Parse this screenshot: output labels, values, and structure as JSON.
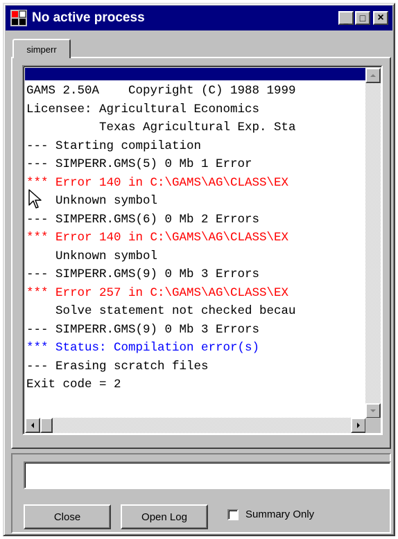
{
  "window": {
    "title": "No active process",
    "icon": "gams-app-icon",
    "controls": {
      "minimize": "_",
      "maximize": "□",
      "close": "×"
    }
  },
  "tabs": [
    {
      "label": "simperr"
    }
  ],
  "log": {
    "lines": [
      {
        "text": "GAMS 2.50A    Copyright (C) 1988 1999",
        "color": "black"
      },
      {
        "text": "Licensee: Agricultural Economics",
        "color": "black"
      },
      {
        "text": "          Texas Agricultural Exp. Sta",
        "color": "black"
      },
      {
        "text": "--- Starting compilation",
        "color": "black"
      },
      {
        "text": "--- SIMPERR.GMS(5) 0 Mb 1 Error",
        "color": "black"
      },
      {
        "text": "*** Error 140 in C:\\GAMS\\AG\\CLASS\\EX",
        "color": "red"
      },
      {
        "text": "    Unknown symbol",
        "color": "black"
      },
      {
        "text": "--- SIMPERR.GMS(6) 0 Mb 2 Errors",
        "color": "black"
      },
      {
        "text": "*** Error 140 in C:\\GAMS\\AG\\CLASS\\EX",
        "color": "red"
      },
      {
        "text": "    Unknown symbol",
        "color": "black"
      },
      {
        "text": "--- SIMPERR.GMS(9) 0 Mb 3 Errors",
        "color": "black"
      },
      {
        "text": "*** Error 257 in C:\\GAMS\\AG\\CLASS\\EX",
        "color": "red"
      },
      {
        "text": "    Solve statement not checked becau",
        "color": "black"
      },
      {
        "text": "--- SIMPERR.GMS(9) 0 Mb 3 Errors",
        "color": "black"
      },
      {
        "text": "*** Status: Compilation error(s)",
        "color": "blue"
      },
      {
        "text": "--- Erasing scratch files",
        "color": "black"
      },
      {
        "text": "Exit code = 2",
        "color": "black"
      }
    ]
  },
  "command_input": {
    "value": "",
    "placeholder": ""
  },
  "buttons": {
    "close": "Close",
    "open_log": "Open Log"
  },
  "summary_only": {
    "label": "Summary Only",
    "checked": false
  },
  "colors": {
    "title_bar": "#000080",
    "error_text": "#ff0000",
    "status_text": "#0000ff",
    "face": "#c0c0c0"
  }
}
